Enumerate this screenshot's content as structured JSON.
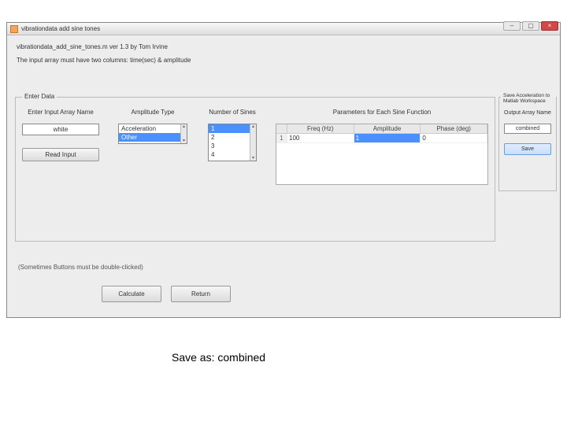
{
  "window": {
    "title": "vibrationdata add sine tones"
  },
  "header": {
    "line1": "vibrationdata_add_sine_tones.m  ver 1.3  by Tom Irvine",
    "line2": "The input array must have two columns: time(sec) & amplitude"
  },
  "enterData": {
    "title": "Enter Data",
    "inputLabel": "Enter Input Array Name",
    "inputValue": "white",
    "readInputBtn": "Read Input",
    "ampTypeLabel": "Amplitude Type",
    "ampTypeItems": [
      "Acceleration",
      "Other"
    ],
    "numSinesLabel": "Number of Sines",
    "numSinesItems": [
      "1",
      "2",
      "3",
      "4"
    ],
    "paramsLabel": "Parameters for Each Sine Function",
    "tableHeaders": [
      "Freq (Hz)",
      "Amplitude",
      "Phase (deg)"
    ],
    "tableRow": {
      "rownum": "1",
      "freq": "100",
      "amp": "1",
      "phase": "0"
    }
  },
  "savePanel": {
    "title": "Save Acceleration to Matlab Workspace",
    "outputLabel": "Output Array Name",
    "outputValue": "combined",
    "saveBtn": "Save"
  },
  "note": "(Sometimes Buttons must be double-clicked)",
  "buttons": {
    "calculate": "Calculate",
    "return": "Return"
  },
  "caption": "Save as:  combined"
}
